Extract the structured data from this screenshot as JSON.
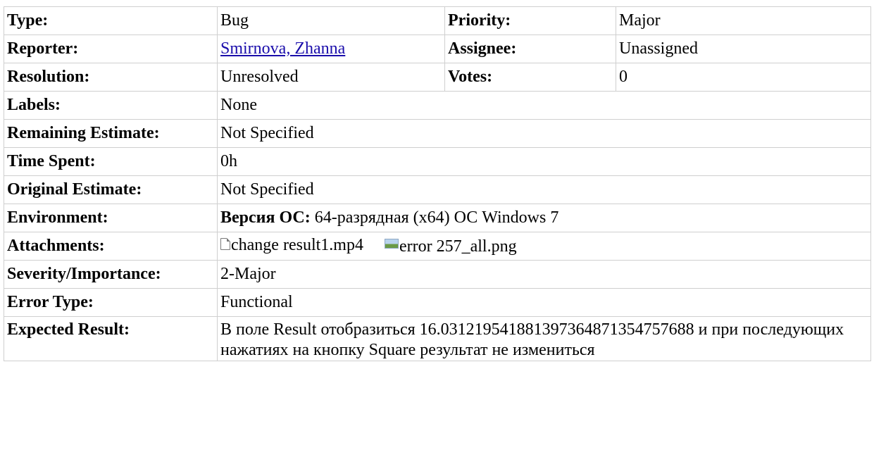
{
  "rows": {
    "type": {
      "label": "Type:",
      "value": "Bug"
    },
    "priority": {
      "label": "Priority:",
      "value": "Major"
    },
    "reporter": {
      "label": "Reporter:",
      "value": "Smirnova, Zhanna"
    },
    "assignee": {
      "label": "Assignee:",
      "value": "Unassigned"
    },
    "resolution": {
      "label": "Resolution:",
      "value": "Unresolved"
    },
    "votes": {
      "label": "Votes:",
      "value": "0"
    },
    "labels": {
      "label": "Labels:",
      "value": "None"
    },
    "remaining_estimate": {
      "label": "Remaining Estimate:",
      "value": "Not Specified"
    },
    "time_spent": {
      "label": "Time Spent:",
      "value": "0h"
    },
    "original_estimate": {
      "label": "Original Estimate:",
      "value": "Not Specified"
    },
    "environment": {
      "label": "Environment:",
      "value_label": "Версия ОС:",
      "value": "64-разрядная (x64) ОС Windows 7"
    },
    "attachments": {
      "label": "Attachments:",
      "files": [
        {
          "name": "change result1.mp4",
          "icon": "file-icon"
        },
        {
          "name": "error 257_all.png",
          "icon": "image-icon"
        }
      ]
    },
    "severity": {
      "label": "Severity/Importance:",
      "value": "2-Major"
    },
    "error_type": {
      "label": "Error Type:",
      "value": "Functional"
    },
    "expected_result": {
      "label": "Expected Result:",
      "value": "В поле Result отобразиться 16.031219541881397364871354757688 и при последующих нажатиях на кнопку Square результат не измениться"
    }
  },
  "colors": {
    "border": "#cfcfcf",
    "link": "#1a0dab"
  }
}
